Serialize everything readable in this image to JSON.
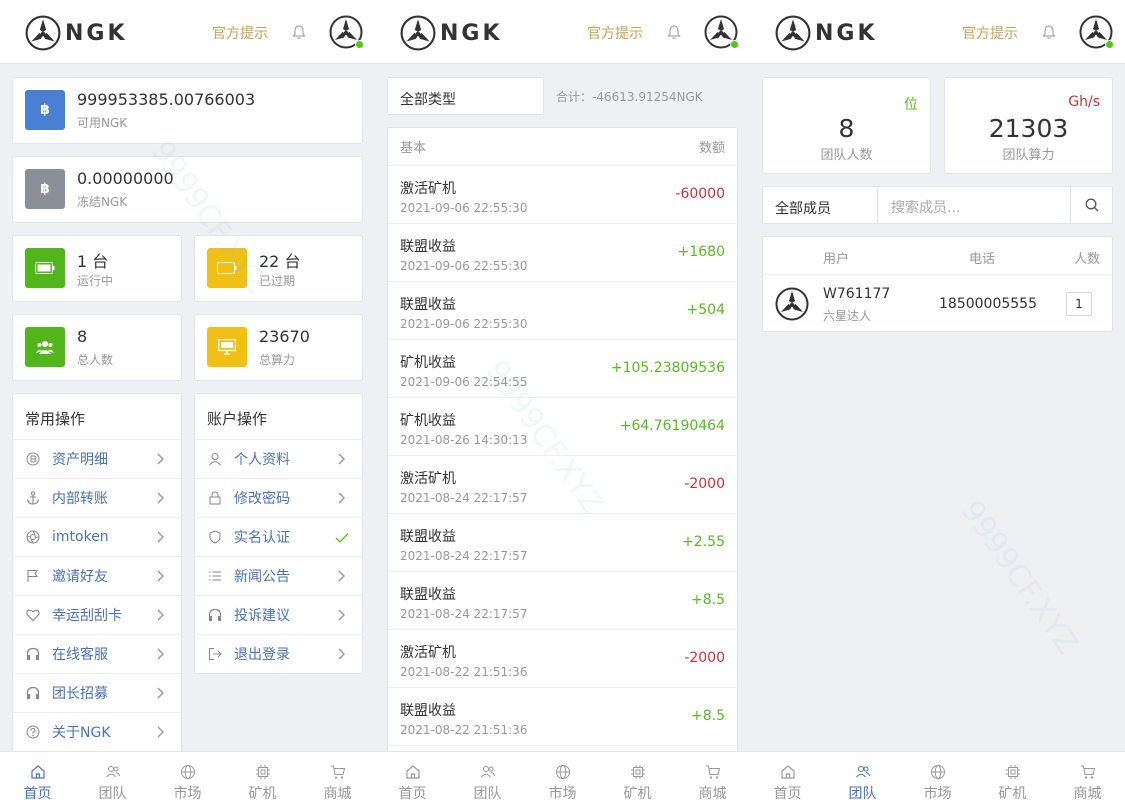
{
  "header": {
    "logo_text": "NGK",
    "hint": "官方提示"
  },
  "watermark": "9999CF.XYZ",
  "tabs": [
    "首页",
    "团队",
    "市场",
    "矿机",
    "商城"
  ],
  "home": {
    "available": {
      "value": "999953385.00766003",
      "label": "可用NGK"
    },
    "frozen": {
      "value": "0.00000000",
      "label": "冻结NGK"
    },
    "running": {
      "value": "1 台",
      "label": "运行中"
    },
    "expired": {
      "value": "22 台",
      "label": "已过期"
    },
    "people": {
      "value": "8",
      "label": "总人数"
    },
    "power": {
      "value": "23670",
      "label": "总算力"
    },
    "common_ops": {
      "title": "常用操作",
      "items": [
        "资产明细",
        "内部转账",
        "imtoken",
        "邀请好友",
        "幸运刮刮卡",
        "在线客服",
        "团长招募",
        "关于NGK"
      ]
    },
    "account_ops": {
      "title": "账户操作",
      "items": [
        "个人资料",
        "修改密码",
        "实名认证",
        "新闻公告",
        "投诉建议",
        "退出登录"
      ]
    }
  },
  "ledger": {
    "filter": "全部类型",
    "total": "合计：-46613.91254NGK",
    "head_left": "基本",
    "head_right": "数额",
    "rows": [
      {
        "title": "激活矿机",
        "date": "2021-09-06 22:55:30",
        "amount": "-60000",
        "neg": true
      },
      {
        "title": "联盟收益",
        "date": "2021-09-06 22:55:30",
        "amount": "+1680",
        "neg": false
      },
      {
        "title": "联盟收益",
        "date": "2021-09-06 22:55:30",
        "amount": "+504",
        "neg": false
      },
      {
        "title": "矿机收益",
        "date": "2021-09-06 22:54:55",
        "amount": "+105.23809536",
        "neg": false
      },
      {
        "title": "矿机收益",
        "date": "2021-08-26 14:30:13",
        "amount": "+64.76190464",
        "neg": false
      },
      {
        "title": "激活矿机",
        "date": "2021-08-24 22:17:57",
        "amount": "-2000",
        "neg": true
      },
      {
        "title": "联盟收益",
        "date": "2021-08-24 22:17:57",
        "amount": "+2.55",
        "neg": false
      },
      {
        "title": "联盟收益",
        "date": "2021-08-24 22:17:57",
        "amount": "+8.5",
        "neg": false
      },
      {
        "title": "激活矿机",
        "date": "2021-08-22 21:51:36",
        "amount": "-2000",
        "neg": true
      },
      {
        "title": "联盟收益",
        "date": "2021-08-22 21:51:36",
        "amount": "+8.5",
        "neg": false
      }
    ]
  },
  "team": {
    "members": {
      "value": "8",
      "label": "团队人数",
      "unit": "位"
    },
    "hashrate": {
      "value": "21303",
      "label": "团队算力",
      "unit": "Gh/s"
    },
    "filter": "全部成员",
    "search_placeholder": "搜索成员...",
    "cols": {
      "user": "用户",
      "phone": "电话",
      "count": "人数"
    },
    "row": {
      "name": "W761177",
      "level": "六星达人",
      "phone": "18500005555",
      "count": "1"
    }
  },
  "colors": {
    "blue": "#4a7fd2",
    "green": "#52b51c",
    "yellow": "#f0c017",
    "gold": "#c9a45a",
    "red": "#c7353d",
    "link": "#4a73b5"
  }
}
